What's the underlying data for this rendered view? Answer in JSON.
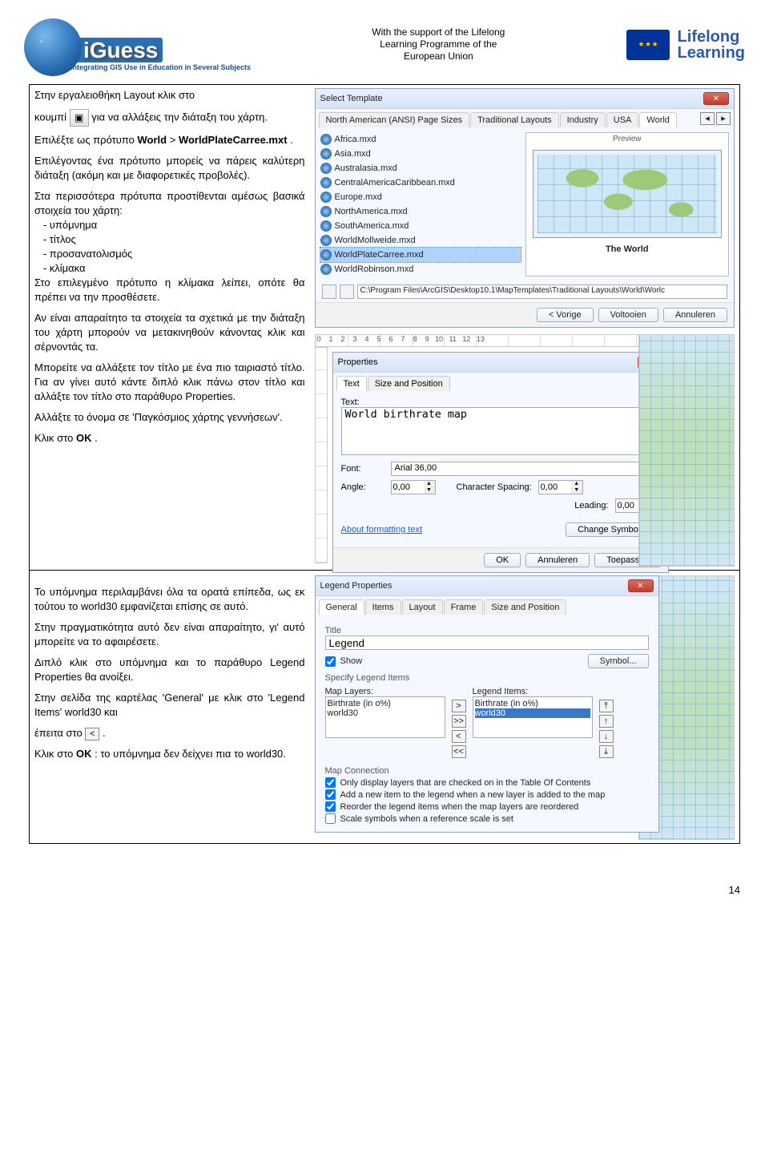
{
  "header": {
    "logo_name": "iGuess",
    "logo_sub": "Integrating GIS Use in Education in Several Subjects",
    "support_l1": "With the support of the Lifelong",
    "support_l2": "Learning Programme of the",
    "support_l3": "European Union",
    "lifelong": "Lifelong",
    "learning": "Learning"
  },
  "section1": {
    "p1a": "Στην εργαλειοθήκη Layout κλικ στο",
    "p1b": "κουμπί ",
    "p1c": " για να αλλάξεις την διάταξη του χάρτη.",
    "p2a": "Επιλέξτε ως πρότυπο ",
    "p2b_world": "World",
    "p2c": " > ",
    "p2d_tpl": "WorldPlateCarree.mxt",
    "p2e": ".",
    "p3": "Επιλέγοντας ένα πρότυπο μπορείς να πάρεις καλύτερη διάταξη (ακόμη και με διαφορετικές προβολές).",
    "p4a": "Στα περισσότερα πρότυπα προστίθενται αμέσως βασικά στοιχεία του χάρτη:",
    "p4_li1": "υπόμνημα",
    "p4_li2": "τίτλος",
    "p4_li3": "προσανατολισμός",
    "p4_li4": "κλίμακα",
    "p4b": "Στο επιλεγμένο πρότυπο η κλίμακα λείπει, οπότε θα πρέπει να την προσθέσετε.",
    "p5": "Αν είναι απαραίτητο τα στοιχεία τα σχετικά με την διάταξη του χάρτη μπορούν να μετακινηθούν κάνοντας κλικ και σέρνοντάς τα.",
    "p6": "Μπορείτε να αλλάξετε τον τίτλο με ένα πιο ταιριαστό τίτλο. Για αν γίνει αυτό κάντε διπλό κλικ πάνω στον τίτλο και αλλάξτε τον τίτλο στο παράθυρο Properties.",
    "p7": "Αλλάξτε το όνομα σε 'Παγκόσμιος χάρτης γεννήσεων'.",
    "p8a": "Κλικ στο ",
    "p8b_ok": "ΟΚ",
    "p8c": "."
  },
  "template_dialog": {
    "title": "Select Template",
    "tabs": [
      "North American (ANSI) Page Sizes",
      "Traditional Layouts",
      "Industry",
      "USA",
      "World"
    ],
    "items": [
      "Africa.mxd",
      "Asia.mxd",
      "Australasia.mxd",
      "CentralAmericaCaribbean.mxd",
      "Europe.mxd",
      "NorthAmerica.mxd",
      "SouthAmerica.mxd",
      "WorldMollweide.mxd",
      "WorldPlateCarree.mxd",
      "WorldRobinson.mxd"
    ],
    "selected_index": 8,
    "preview_label": "Preview",
    "preview_caption": "The World",
    "path": "C:\\Program Files\\ArcGIS\\Desktop10.1\\MapTemplates\\Traditional Layouts\\World\\Worlc",
    "btn_back": "< Vorige",
    "btn_finish": "Voltooien",
    "btn_cancel": "Annuleren"
  },
  "properties_dialog": {
    "win_title": "Properties",
    "tabs": [
      "Text",
      "Size and Position"
    ],
    "text_label": "Text:",
    "text_value": "World birthrate map",
    "font_label": "Font:",
    "font_value": "Arial 36,00",
    "angle_label": "Angle:",
    "angle_value": "0,00",
    "charspacing_label": "Character Spacing:",
    "charspacing_value": "0,00",
    "leading_label": "Leading:",
    "leading_value": "0,00",
    "about_link": "About formatting text",
    "btn_changesym": "Change Symbol...",
    "btn_ok": "OK",
    "btn_cancel": "Annuleren",
    "btn_apply": "Toepassen"
  },
  "section2": {
    "p1": "Το υπόμνημα περιλαμβάνει όλα τα ορατά επίπεδα, ως εκ τούτου το world30 εμφανίζεται επίσης σε αυτό.",
    "p2": "Στην πραγματικότητα αυτό δεν είναι απαραίτητο, γι' αυτό μπορείτε να το αφαιρέσετε.",
    "p3": "Διπλό κλικ στο υπόμνημα και το παράθυρο Legend Properties θα ανοίξει.",
    "p4a": "Στην σελίδα της καρτέλας 'General' με κλικ στο 'Legend Items' world30 και",
    "p4b": "έπειτα στο ",
    "p4c": ".",
    "p5a": "Κλικ στο ",
    "p5b_ok": "ΟΚ",
    "p5c": ": το υπόμνημα δεν δείχνει πια το world30."
  },
  "legend_dialog": {
    "win_title": "Legend Properties",
    "tabs": [
      "General",
      "Items",
      "Layout",
      "Frame",
      "Size and Position"
    ],
    "title_group": "Title",
    "title_value": "Legend",
    "show_check": "Show",
    "symbol_btn": "Symbol...",
    "specify_label": "Specify Legend Items",
    "map_layers_hdr": "Map Layers:",
    "legend_items_hdr": "Legend Items:",
    "map_layers": [
      "Birthrate (in o%)",
      "world30"
    ],
    "legend_items": [
      "Birthrate (in o%)",
      "world30"
    ],
    "legend_sel_index": 1,
    "mapconn_label": "Map Connection",
    "chk1": "Only display layers that are checked on in the Table Of Contents",
    "chk2": "Add a new item to the legend when a new layer is added to the map",
    "chk3": "Reorder the legend items when the map layers are reordered",
    "chk4": "Scale symbols when a reference scale is set"
  },
  "page_num": "14"
}
